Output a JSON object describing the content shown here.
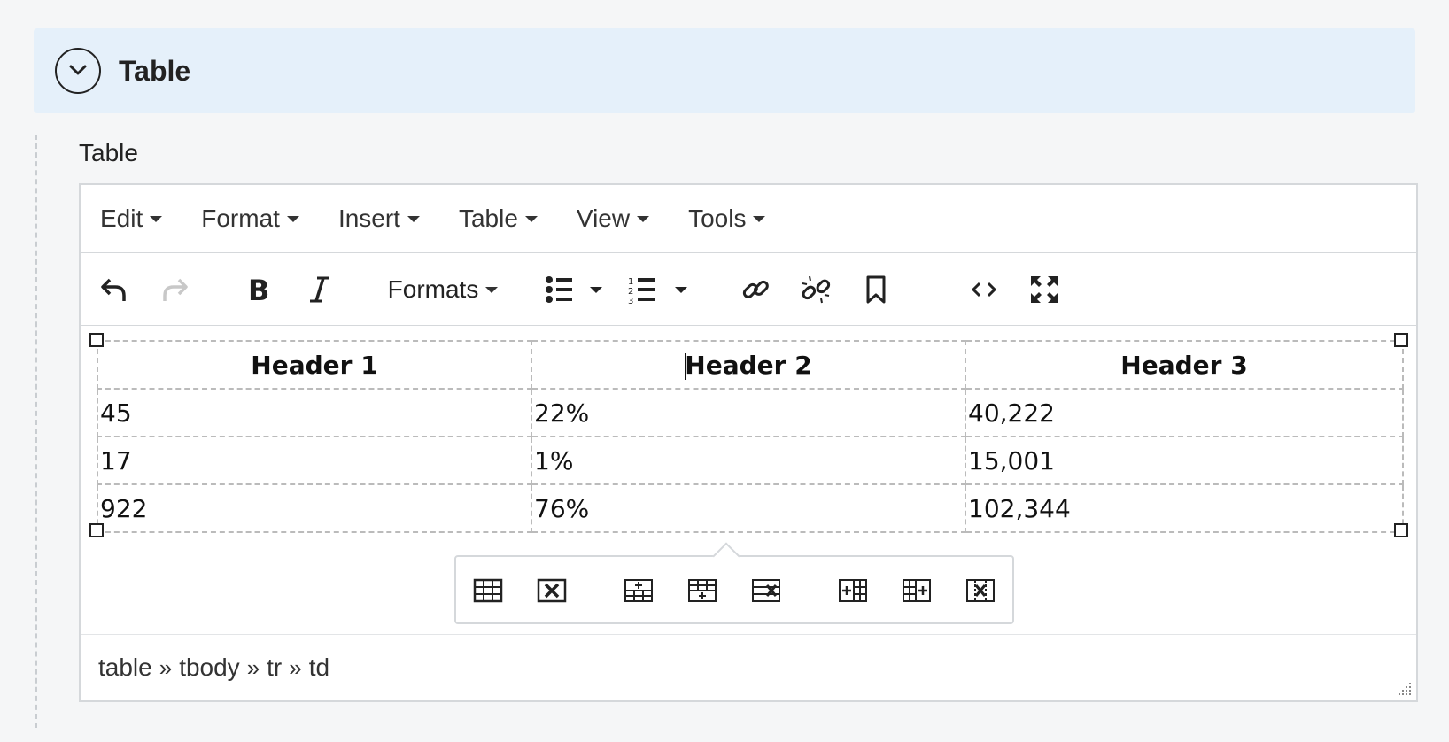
{
  "section": {
    "title": "Table"
  },
  "field": {
    "label": "Table"
  },
  "menubar": {
    "items": [
      {
        "label": "Edit"
      },
      {
        "label": "Format"
      },
      {
        "label": "Insert"
      },
      {
        "label": "Table"
      },
      {
        "label": "View"
      },
      {
        "label": "Tools"
      }
    ]
  },
  "toolbar": {
    "formats_label": "Formats",
    "buttons": [
      "undo-icon",
      "redo-icon",
      "bold-icon",
      "italic-icon",
      "bullet-list-icon",
      "numbered-list-icon",
      "link-icon",
      "unlink-icon",
      "bookmark-icon",
      "source-code-icon",
      "fullscreen-icon"
    ]
  },
  "table": {
    "headers": [
      "Header 1",
      "Header 2",
      "Header 3"
    ],
    "rows": [
      [
        "45",
        "22%",
        "40,222"
      ],
      [
        "17",
        "1%",
        "15,001"
      ],
      [
        "922",
        "76%",
        "102,344"
      ]
    ]
  },
  "context_toolbar": {
    "buttons": [
      "table-properties-icon",
      "delete-table-icon",
      "insert-row-before-icon",
      "insert-row-after-icon",
      "delete-row-icon",
      "insert-column-before-icon",
      "insert-column-after-icon",
      "delete-column-icon"
    ]
  },
  "statusbar": {
    "path": [
      "table",
      "tbody",
      "tr",
      "td"
    ],
    "separator": "»"
  }
}
